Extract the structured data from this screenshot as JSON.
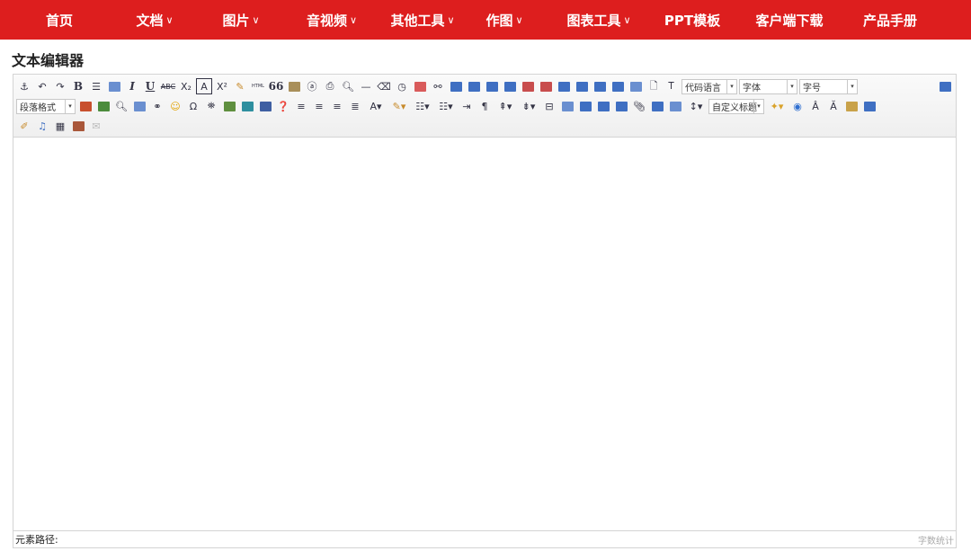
{
  "nav": {
    "items": [
      {
        "label": "首页",
        "dropdown": false
      },
      {
        "label": "文档",
        "dropdown": true
      },
      {
        "label": "图片",
        "dropdown": true
      },
      {
        "label": "音视频",
        "dropdown": true
      },
      {
        "label": "其他工具",
        "dropdown": true
      },
      {
        "label": "作图",
        "dropdown": true
      },
      {
        "label": "图表工具",
        "dropdown": true
      },
      {
        "label": "PPT模板",
        "dropdown": false
      },
      {
        "label": "客户端下载",
        "dropdown": false
      },
      {
        "label": "产品手册",
        "dropdown": false
      }
    ],
    "chevron": "∨"
  },
  "page": {
    "title": "文本编辑器"
  },
  "toolbar": {
    "text_buttons": {
      "bold": "B",
      "italic": "I",
      "underline": "U",
      "text_letter": "A",
      "omega": "Ω",
      "quote": "66",
      "html": "HTML"
    },
    "selects": {
      "code_language": "代码语言",
      "font_family": "字体",
      "font_size": "字号",
      "paragraph_format": "段落格式",
      "custom_heading": "自定义标题"
    }
  },
  "statusbar": {
    "path_label": "元素路径:",
    "word_count": "字数统计"
  },
  "colors": {
    "nav_bg": "#dd1e1e",
    "nav_text": "#ffffff"
  }
}
